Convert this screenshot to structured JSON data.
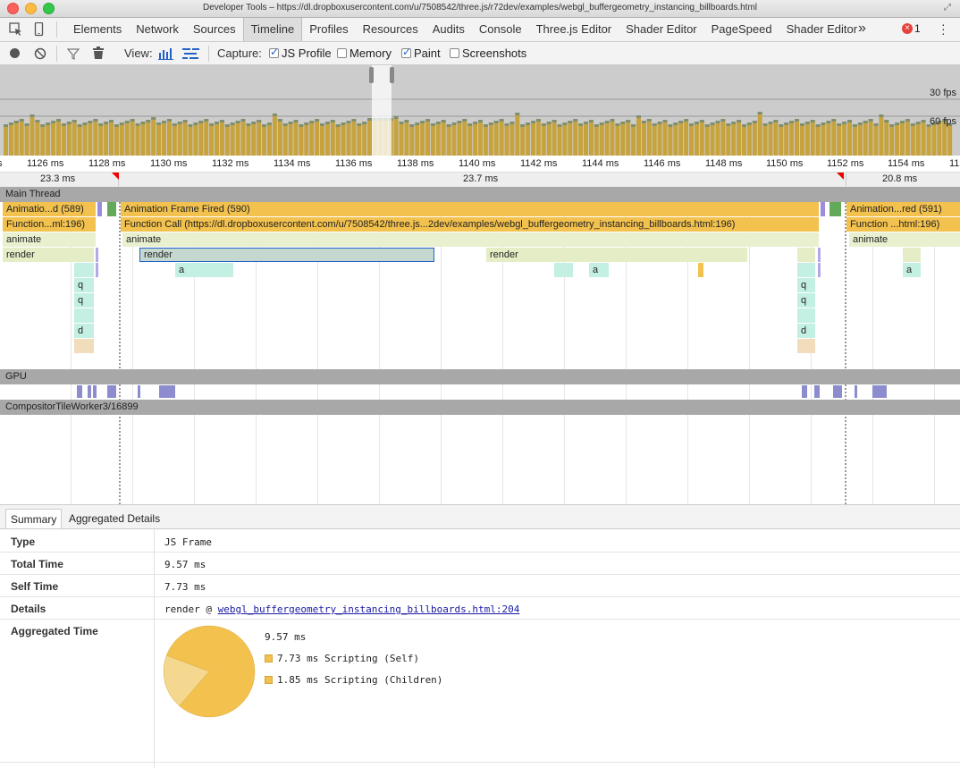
{
  "window": {
    "title": "Developer Tools – https://dl.dropboxusercontent.com/u/7508542/three.js/r72dev/examples/webgl_buffergeometry_instancing_billboards.html"
  },
  "tabs": [
    "Elements",
    "Network",
    "Sources",
    "Timeline",
    "Profiles",
    "Resources",
    "Audits",
    "Console",
    "Three.js Editor",
    "Shader Editor",
    "PageSpeed",
    "Shader Editor"
  ],
  "active_tab": "Timeline",
  "overflow": "»",
  "error_count": "1",
  "toolbar": {
    "view_label": "View:",
    "capture_label": "Capture:",
    "js_profile": "JS Profile",
    "memory": "Memory",
    "paint": "Paint",
    "screenshots": "Screenshots"
  },
  "overview": {
    "fps30": "30 fps",
    "fps60": "60 fps"
  },
  "ruler": {
    "ticks": [
      "s",
      "1126 ms",
      "1128 ms",
      "1130 ms",
      "1132 ms",
      "1134 ms",
      "1136 ms",
      "1138 ms",
      "1140 ms",
      "1142 ms",
      "1144 ms",
      "1146 ms",
      "1148 ms",
      "1150 ms",
      "1152 ms",
      "1154 ms",
      "11"
    ]
  },
  "frames": [
    "23.3 ms",
    "23.7 ms",
    "20.8 ms"
  ],
  "tracks": {
    "main": "Main Thread",
    "gpu": "GPU",
    "compositor": "CompositorTileWorker3/16899"
  },
  "flame": {
    "anim1": "Animatio...d (589)",
    "anim2": "Animation Frame Fired (590)",
    "anim3": "Animation...red (591)",
    "func1": "Function...ml:196)",
    "func2": "Function Call (https://dl.dropboxusercontent.com/u/7508542/three.js...2dev/examples/webgl_buffergeometry_instancing_billboards.html:196)",
    "func3": "Function ...html:196)",
    "animate": "animate",
    "render": "render",
    "a": "a",
    "q": "q",
    "d": "d"
  },
  "summary": {
    "tabs": [
      "Summary",
      "Aggregated Details"
    ],
    "type_label": "Type",
    "type_value": "JS Frame",
    "total_label": "Total Time",
    "total_value": "9.57 ms",
    "self_label": "Self Time",
    "self_value": "7.73 ms",
    "details_label": "Details",
    "details_prefix": "render @ ",
    "details_link": "webgl_buffergeometry_instancing_billboards.html:204",
    "agg_label": "Aggregated Time",
    "agg_total": "9.57 ms",
    "legend": [
      {
        "label": "7.73 ms Scripting (Self)",
        "value": 7.73
      },
      {
        "label": "1.85 ms Scripting (Children)",
        "value": 1.85
      }
    ]
  },
  "colors": {
    "scripting": "#f2c14e",
    "scripting_light": "#f5d88f",
    "gpu": "#8c8ccf",
    "selection": "#2262c6"
  }
}
